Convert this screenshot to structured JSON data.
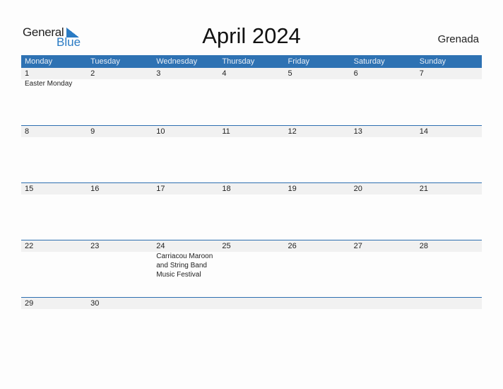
{
  "logo": {
    "word1": "General",
    "word2": "Blue",
    "accent": "#2a7bc4"
  },
  "header": {
    "title": "April 2024",
    "country": "Grenada"
  },
  "colors": {
    "header_bg": "#2e72b3",
    "row_band": "#f1f1f1",
    "divider": "#2e6fb0"
  },
  "weekdays": [
    "Monday",
    "Tuesday",
    "Wednesday",
    "Thursday",
    "Friday",
    "Saturday",
    "Sunday"
  ],
  "weeks": [
    [
      {
        "day": "1",
        "event": "Easter Monday"
      },
      {
        "day": "2",
        "event": ""
      },
      {
        "day": "3",
        "event": ""
      },
      {
        "day": "4",
        "event": ""
      },
      {
        "day": "5",
        "event": ""
      },
      {
        "day": "6",
        "event": ""
      },
      {
        "day": "7",
        "event": ""
      }
    ],
    [
      {
        "day": "8",
        "event": ""
      },
      {
        "day": "9",
        "event": ""
      },
      {
        "day": "10",
        "event": ""
      },
      {
        "day": "11",
        "event": ""
      },
      {
        "day": "12",
        "event": ""
      },
      {
        "day": "13",
        "event": ""
      },
      {
        "day": "14",
        "event": ""
      }
    ],
    [
      {
        "day": "15",
        "event": ""
      },
      {
        "day": "16",
        "event": ""
      },
      {
        "day": "17",
        "event": ""
      },
      {
        "day": "18",
        "event": ""
      },
      {
        "day": "19",
        "event": ""
      },
      {
        "day": "20",
        "event": ""
      },
      {
        "day": "21",
        "event": ""
      }
    ],
    [
      {
        "day": "22",
        "event": ""
      },
      {
        "day": "23",
        "event": ""
      },
      {
        "day": "24",
        "event": "Carriacou Maroon and String Band Music Festival"
      },
      {
        "day": "25",
        "event": ""
      },
      {
        "day": "26",
        "event": ""
      },
      {
        "day": "27",
        "event": ""
      },
      {
        "day": "28",
        "event": ""
      }
    ],
    [
      {
        "day": "29",
        "event": ""
      },
      {
        "day": "30",
        "event": ""
      },
      {
        "day": "",
        "event": ""
      },
      {
        "day": "",
        "event": ""
      },
      {
        "day": "",
        "event": ""
      },
      {
        "day": "",
        "event": ""
      },
      {
        "day": "",
        "event": ""
      }
    ]
  ]
}
